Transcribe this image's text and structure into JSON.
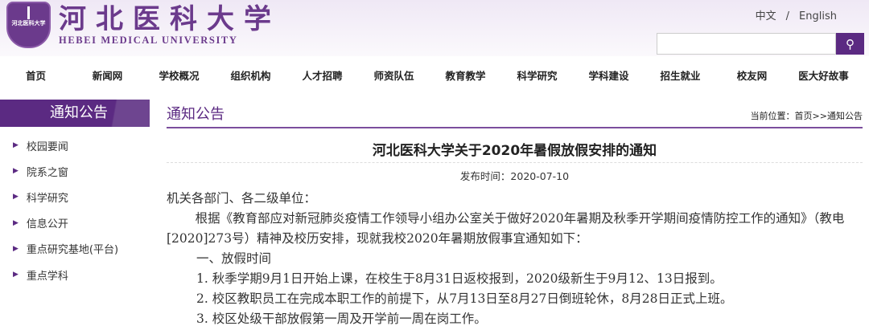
{
  "header": {
    "logo_cn": "河北医科大学",
    "logo_en": "HEBEI MEDICAL UNIVERSITY",
    "seal_text": "河北医科大学",
    "lang_cn": "中文",
    "lang_sep": "/",
    "lang_en": "English",
    "search_placeholder": "",
    "search_icon": "search-icon"
  },
  "nav": [
    "首页",
    "新闻网",
    "学校概况",
    "组织机构",
    "人才招聘",
    "师资队伍",
    "教育教学",
    "科学研究",
    "学科建设",
    "招生就业",
    "校友网",
    "医大好故事"
  ],
  "sidebar": {
    "title": "通知公告",
    "items": [
      "校园要闻",
      "院系之窗",
      "科学研究",
      "信息公开",
      "重点研究基地(平台)",
      "重点学科"
    ]
  },
  "main": {
    "section_title": "通知公告",
    "breadcrumb": "当前位置：首页>>通知公告",
    "article": {
      "title": "河北医科大学关于2020年暑假放假安排的通知",
      "date": "发布时间：2020-07-10",
      "paragraphs": [
        "机关各部门、各二级单位：",
        "根据《教育部应对新冠肺炎疫情工作领导小组办公室关于做好2020年暑期及秋季开学期间疫情防控工作的通知》（教电[2020]273号）精神及校历安排，现就我校2020年暑期放假事宜通知如下：",
        "一、放假时间",
        "1. 秋季学期9月1日开始上课，在校生于8月31日返校报到，2020级新生于9月12、13日报到。",
        "2. 校区教职员工在完成本职工作的前提下，从7月13日至8月27日倒班轮休，8月28日正式上班。",
        "3. 校区处级干部放假第一周及开学前一周在岗工作。"
      ]
    }
  }
}
